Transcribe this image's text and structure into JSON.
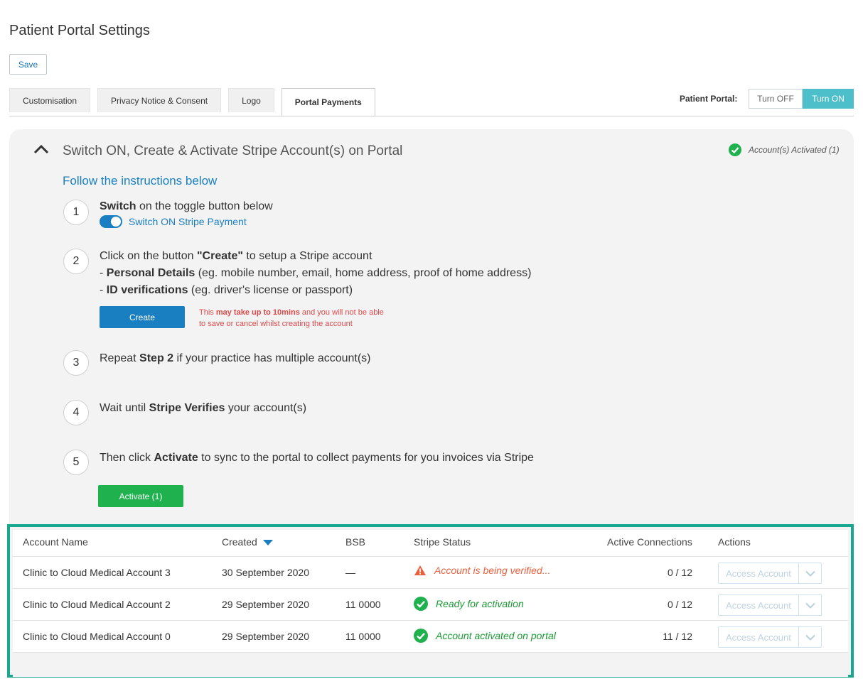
{
  "page": {
    "title": "Patient Portal Settings",
    "save_label": "Save"
  },
  "tabs": [
    {
      "label": "Customisation",
      "active": false
    },
    {
      "label": "Privacy Notice & Consent",
      "active": false
    },
    {
      "label": "Logo",
      "active": false
    },
    {
      "label": "Portal Payments",
      "active": true
    }
  ],
  "portal_toggle": {
    "label": "Patient Portal:",
    "off_label": "Turn OFF",
    "on_label": "Turn ON",
    "state": "on"
  },
  "section": {
    "title": "Switch ON, Create & Activate Stripe Account(s) on Portal",
    "status_text": "Account(s) Activated (1)",
    "follow_text": "Follow the instructions below"
  },
  "steps": {
    "s1": {
      "num": "1",
      "bold": "Switch",
      "rest": " on the toggle button below",
      "switch_label": "Switch ON Stripe Payment"
    },
    "s2": {
      "num": "2",
      "line1_a": "Click on the button ",
      "line1_b": "\"Create\"",
      "line1_c": " to setup a Stripe account",
      "line2_a": "- ",
      "line2_b": "Personal Details",
      "line2_c": " (eg. mobile number, email, home address, proof of home address)",
      "line3_a": "- ",
      "line3_b": "ID verifications",
      "line3_c": " (eg. driver's license or passport)",
      "create_label": "Create",
      "note_a": "This ",
      "note_b": "may take up to 10mins",
      "note_c": " and you will not be able to save or cancel whilst creating the account"
    },
    "s3": {
      "num": "3",
      "a": "Repeat ",
      "b": "Step 2",
      "c": " if your practice has multiple account(s)"
    },
    "s4": {
      "num": "4",
      "a": "Wait until ",
      "b": "Stripe Verifies",
      "c": " your account(s)"
    },
    "s5": {
      "num": "5",
      "a": "Then click ",
      "b": "Activate",
      "c": " to sync to the portal to collect payments for you invoices via Stripe",
      "activate_label": "Activate (1)"
    }
  },
  "table": {
    "headers": {
      "name": "Account Name",
      "created": "Created",
      "bsb": "BSB",
      "status": "Stripe Status",
      "connections": "Active Connections",
      "actions": "Actions"
    },
    "rows": [
      {
        "name": "Clinic to Cloud Medical Account 3",
        "created": "30 September 2020",
        "bsb": "—",
        "status": "Account is being verified...",
        "status_type": "warning",
        "connections": "0 / 12",
        "action": "Access Account"
      },
      {
        "name": "Clinic to Cloud Medical Account 2",
        "created": "29 September 2020",
        "bsb": "11 0000",
        "status": "Ready for activation",
        "status_type": "success",
        "connections": "0 / 12",
        "action": "Access Account"
      },
      {
        "name": "Clinic to Cloud Medical Account 0",
        "created": "29 September 2020",
        "bsb": "11 0000",
        "status": "Account activated on portal",
        "status_type": "success",
        "connections": "11 / 12",
        "action": "Access Account"
      }
    ]
  },
  "colors": {
    "accent_blue": "#1a7fc1",
    "teal": "#4dbfca",
    "green": "#1fb14d",
    "warning": "#e8603e",
    "frame": "#17a88f"
  }
}
